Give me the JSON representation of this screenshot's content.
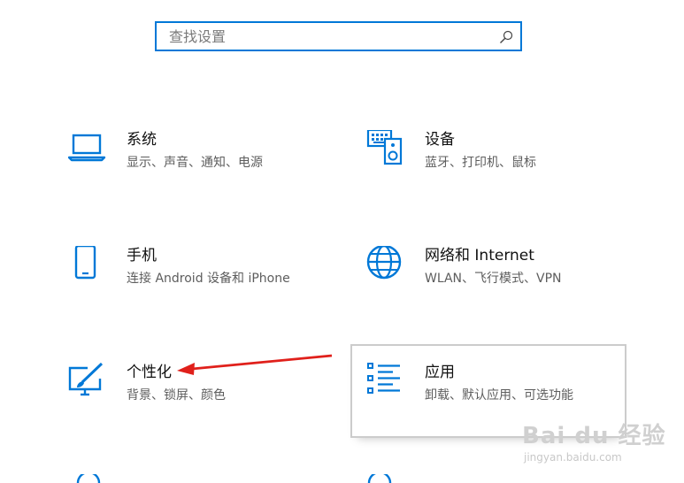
{
  "search": {
    "placeholder": "查找设置",
    "icon": "search-icon"
  },
  "tiles": [
    {
      "title": "系统",
      "desc": "显示、声音、通知、电源",
      "icon": "laptop-icon"
    },
    {
      "title": "设备",
      "desc": "蓝牙、打印机、鼠标",
      "icon": "keyboard-speaker-icon"
    },
    {
      "title": "手机",
      "desc": "连接 Android 设备和 iPhone",
      "icon": "phone-icon"
    },
    {
      "title": "网络和 Internet",
      "desc": "WLAN、飞行模式、VPN",
      "icon": "globe-icon"
    },
    {
      "title": "个性化",
      "desc": "背景、锁屏、颜色",
      "icon": "paintbrush-screen-icon"
    },
    {
      "title": "应用",
      "desc": "卸载、默认应用、可选功能",
      "icon": "apps-list-icon"
    }
  ],
  "annotation": {
    "arrow_color": "#e0201b",
    "points_to": "个性化"
  },
  "watermark": {
    "brand": "Bai du 经验",
    "url": "jingyan.baidu.com"
  },
  "colors": {
    "accent": "#0078d7",
    "text": "#1a1a1a",
    "subtext": "#5d5d5d"
  }
}
